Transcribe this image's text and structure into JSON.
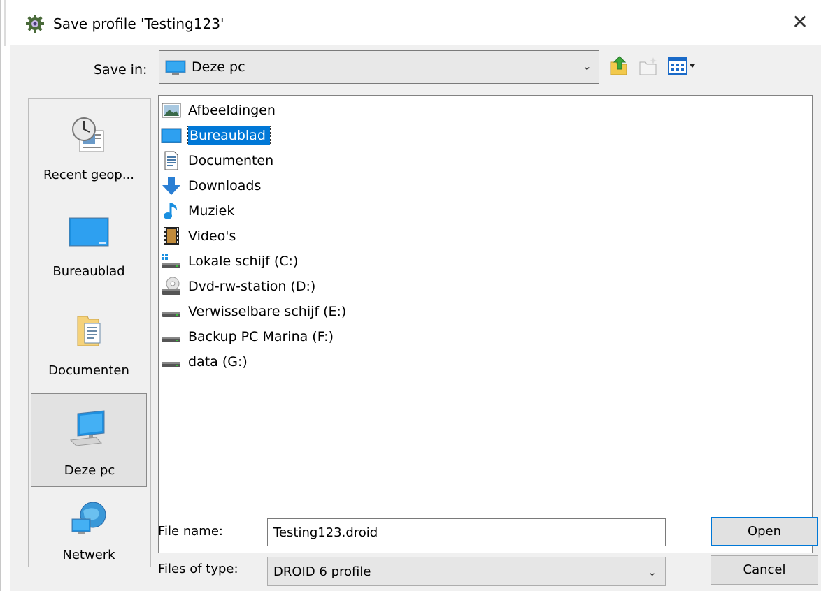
{
  "window": {
    "title": "Save profile 'Testing123'",
    "close": "✕"
  },
  "save_in": {
    "label": "Save in:",
    "value": "Deze pc"
  },
  "places": [
    {
      "label": "Recent geop...",
      "icon": "recent-icon"
    },
    {
      "label": "Bureaublad",
      "icon": "desktop-icon"
    },
    {
      "label": "Documenten",
      "icon": "documents-folder-icon"
    },
    {
      "label": "Deze pc",
      "icon": "computer-icon",
      "selected": true
    },
    {
      "label": "Netwerk",
      "icon": "network-icon"
    }
  ],
  "files": [
    {
      "name": "Afbeeldingen",
      "icon": "pictures-icon"
    },
    {
      "name": "Bureaublad",
      "icon": "desktop-icon",
      "selected": true
    },
    {
      "name": "Documenten",
      "icon": "document-icon"
    },
    {
      "name": "Downloads",
      "icon": "download-arrow-icon"
    },
    {
      "name": "Muziek",
      "icon": "music-note-icon"
    },
    {
      "name": "Video's",
      "icon": "film-icon"
    },
    {
      "name": "Lokale schijf (C:)",
      "icon": "windows-drive-icon"
    },
    {
      "name": "Dvd-rw-station (D:)",
      "icon": "dvd-drive-icon"
    },
    {
      "name": "Verwisselbare schijf (E:)",
      "icon": "drive-icon"
    },
    {
      "name": "Backup PC Marina (F:)",
      "icon": "drive-icon"
    },
    {
      "name": "data (G:)",
      "icon": "drive-icon"
    }
  ],
  "file_name": {
    "label": "File name:",
    "value": "Testing123.droid"
  },
  "file_type": {
    "label": "Files of type:",
    "value": "DROID 6 profile"
  },
  "buttons": {
    "open": "Open",
    "cancel": "Cancel"
  },
  "colors": {
    "selection": "#0078d7",
    "dialog_bg": "#f0f0f0"
  }
}
